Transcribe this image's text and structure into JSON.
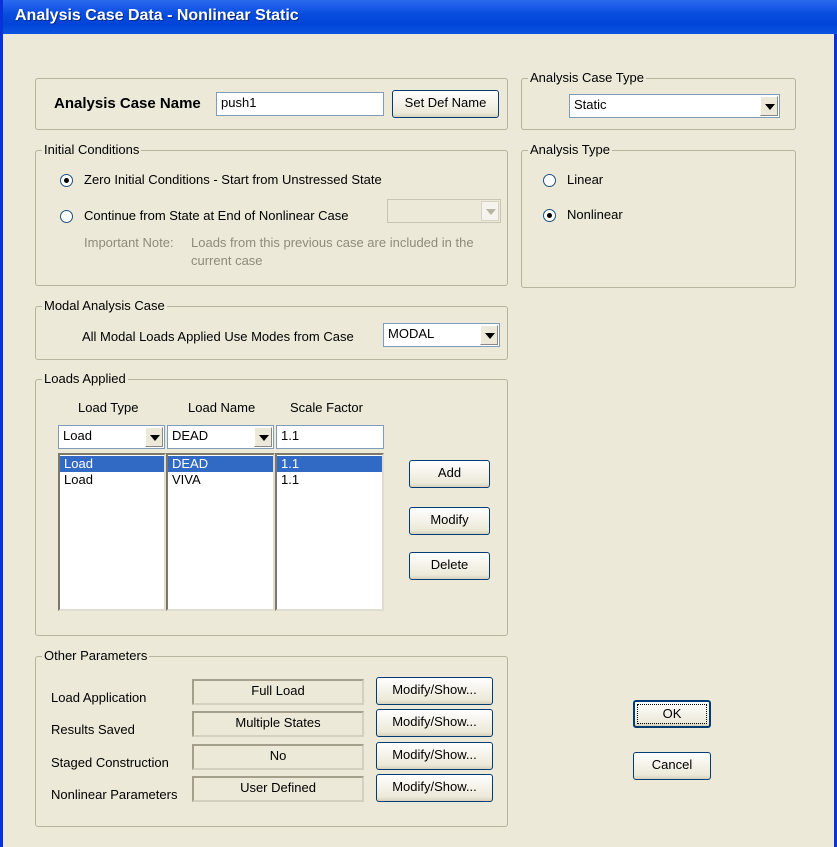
{
  "window": {
    "title": "Analysis Case Data - Nonlinear Static"
  },
  "case_name": {
    "label": "Analysis Case Name",
    "value": "push1",
    "set_def_button": "Set Def Name"
  },
  "case_type": {
    "legend": "Analysis Case Type",
    "selected": "Static"
  },
  "initial_conditions": {
    "legend": "Initial Conditions",
    "option_zero": "Zero Initial Conditions - Start from Unstressed State",
    "option_continue": "Continue from State at End of Nonlinear Case",
    "note_label": "Important Note:",
    "note_line1": "Loads from this previous case are included in the",
    "note_line2": "current case",
    "selected": "zero"
  },
  "analysis_type": {
    "legend": "Analysis Type",
    "option_linear": "Linear",
    "option_nonlinear": "Nonlinear",
    "selected": "nonlinear"
  },
  "modal": {
    "legend": "Modal Analysis Case",
    "label": "All Modal Loads Applied Use Modes from Case",
    "selected": "MODAL"
  },
  "loads": {
    "legend": "Loads Applied",
    "col_type": "Load Type",
    "col_name": "Load Name",
    "col_factor": "Scale Factor",
    "edit_type": "Load",
    "edit_name": "DEAD",
    "edit_factor": "1.1",
    "rows": [
      {
        "type": "Load",
        "name": "DEAD",
        "factor": "1.1"
      },
      {
        "type": "Load",
        "name": "VIVA",
        "factor": "1.1"
      }
    ],
    "add_button": "Add",
    "modify_button": "Modify",
    "delete_button": "Delete"
  },
  "other": {
    "legend": "Other Parameters",
    "button": "Modify/Show...",
    "params": [
      {
        "label": "Load Application",
        "value": "Full Load"
      },
      {
        "label": "Results Saved",
        "value": "Multiple States"
      },
      {
        "label": "Staged Construction",
        "value": "No"
      },
      {
        "label": "Nonlinear Parameters",
        "value": "User Defined"
      }
    ]
  },
  "ok_button": "OK",
  "cancel_button": "Cancel"
}
